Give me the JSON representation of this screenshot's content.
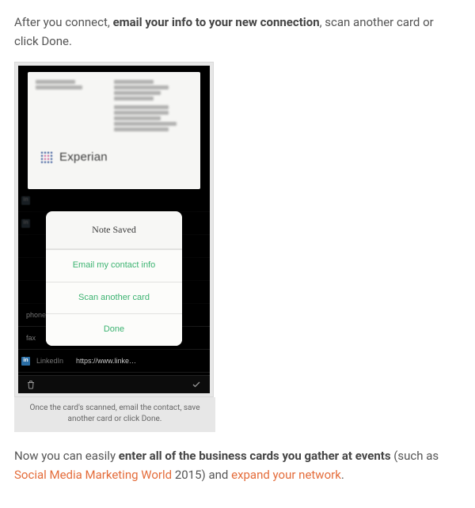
{
  "intro": {
    "before": "After you connect, ",
    "bold": "email your info to your new connection",
    "after": ", scan another card or click Done."
  },
  "phone": {
    "card": {
      "logo_text": "Experian"
    },
    "dialog": {
      "title": "Note Saved",
      "btn_email": "Email my contact info",
      "btn_scan": "Scan another card",
      "btn_done": "Done"
    },
    "rows": {
      "phone_label": "phone",
      "fax_label": "fax",
      "linkedin_label": "LinkedIn",
      "linkedin_value": "https://www.linke…"
    }
  },
  "caption": "Once the card's scanned, email the contact, save another card or click Done.",
  "outro": {
    "before": "Now you can easily ",
    "bold": "enter all of the business cards you gather at events",
    "mid1": " (such as ",
    "link1": "Social Media Marketing World",
    "mid2": " 2015) and ",
    "link2": "expand your network",
    "after": "."
  }
}
